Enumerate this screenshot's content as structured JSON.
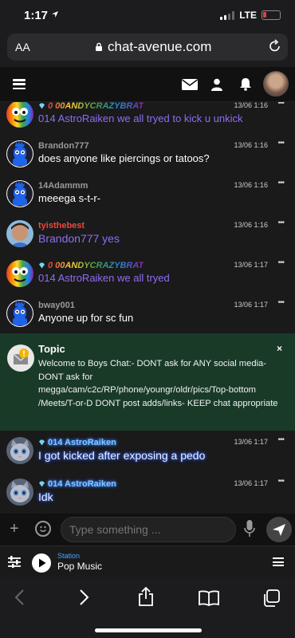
{
  "status_bar": {
    "time": "1:17",
    "network": "LTE"
  },
  "browser": {
    "text_size_label": "AA",
    "url": "chat-avenue.com"
  },
  "chat": {
    "messages": [
      {
        "name": "0 00ANDYCRAZYBRAT",
        "text": "014 AstroRaiken we all tryed to kick u unkick",
        "time": "13/06 1:16",
        "menu": "•••"
      },
      {
        "name": "Brandon777",
        "text": "does anyone like piercings or tatoos?",
        "time": "13/06 1:16",
        "menu": "•••"
      },
      {
        "name": "14Adammm",
        "text": "meeega s-t-r-",
        "time": "13/06 1:16",
        "menu": "•••"
      },
      {
        "name": "tyisthebest",
        "text": "Brandon777 yes",
        "time": "13/06 1:16",
        "menu": "•••"
      },
      {
        "name": "0 00ANDYCRAZYBRAT",
        "text": "014 AstroRaiken we all tryed",
        "time": "13/06 1:17",
        "menu": "•••"
      },
      {
        "name": "bway001",
        "text": "Anyone up for sc fun",
        "time": "13/06 1:17",
        "menu": "•••"
      }
    ],
    "topic": {
      "title": "Topic",
      "close": "×",
      "body": "Welcome to Boys Chat:- DONT ask for ANY social media- DONT ask for megga/cam/c2c/RP/phone/youngr/oldr/pics/Top-bottom /Meets/T-or-D DONT post adds/links- KEEP chat appropriate"
    },
    "messages_after": [
      {
        "name": "014 AstroRaiken",
        "text": "I got kicked after exposing a pedo",
        "time": "13/06 1:17",
        "menu": "•••"
      },
      {
        "name": "014 AstroRaiken",
        "text": "Idk",
        "time": "13/06 1:17",
        "menu": "•••"
      }
    ]
  },
  "input": {
    "placeholder": "Type something ..."
  },
  "player": {
    "label": "Station",
    "name": "Pop Music"
  },
  "colors": {
    "accent_blue": "#4aa3ff",
    "topic_bg": "#1a3a28",
    "purple_text": "#8f6df5",
    "red_name": "#f0453a"
  }
}
